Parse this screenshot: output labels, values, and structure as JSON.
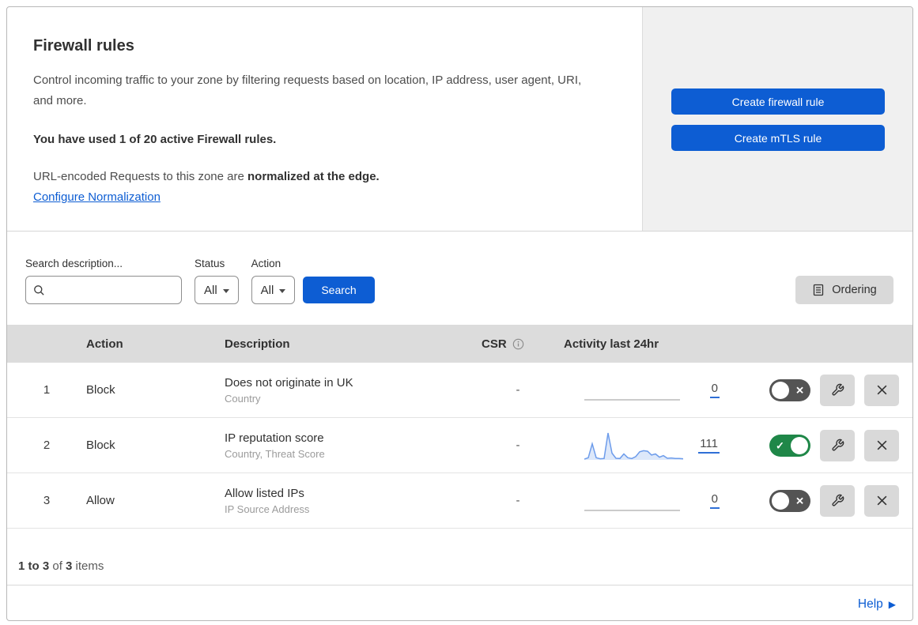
{
  "colors": {
    "accent_blue": "#0d5dd3",
    "toggle_on_green": "#1f8748",
    "toggle_off_gray": "#545454",
    "spark_line": "#6d9ceb",
    "spark_fill": "#dde8fa",
    "flat_line_gray": "#cbcbcb"
  },
  "header": {
    "title": "Firewall rules",
    "description": "Control incoming traffic to your zone by filtering requests based on location, IP address, user agent, URI, and more.",
    "usage_note": "You have used 1 of 20 active Firewall rules.",
    "normalization_text": "URL-encoded Requests to this zone are ",
    "normalization_bold": "normalized at the edge.",
    "normalization_link": "Configure Normalization",
    "create_firewall_button": "Create firewall rule",
    "create_mtls_button": "Create mTLS rule"
  },
  "filters": {
    "search_label": "Search description...",
    "status_label": "Status",
    "status_value": "All",
    "action_label": "Action",
    "action_value": "All",
    "search_button": "Search",
    "ordering_button": "Ordering"
  },
  "table": {
    "headers": {
      "action": "Action",
      "description": "Description",
      "csr": "CSR",
      "activity": "Activity last 24hr"
    },
    "rows": [
      {
        "index": "1",
        "action": "Block",
        "title": "Does not originate in UK",
        "subtitle": "Country",
        "csr": "-",
        "count": "0",
        "enabled": false,
        "sparkline": []
      },
      {
        "index": "2",
        "action": "Block",
        "title": "IP reputation score",
        "subtitle": "Country, Threat Score",
        "csr": "-",
        "count": "111",
        "enabled": true,
        "sparkline": [
          3,
          8,
          60,
          8,
          4,
          5,
          100,
          25,
          6,
          5,
          22,
          8,
          5,
          12,
          30,
          34,
          32,
          18,
          22,
          10,
          16,
          6,
          7,
          5,
          5,
          4
        ]
      },
      {
        "index": "3",
        "action": "Allow",
        "title": "Allow listed IPs",
        "subtitle": "IP Source Address",
        "csr": "-",
        "count": "0",
        "enabled": false,
        "sparkline": []
      }
    ]
  },
  "footer": {
    "range": "1 to 3",
    "of": " of ",
    "total": "3",
    "items_word": " items",
    "help": "Help"
  }
}
